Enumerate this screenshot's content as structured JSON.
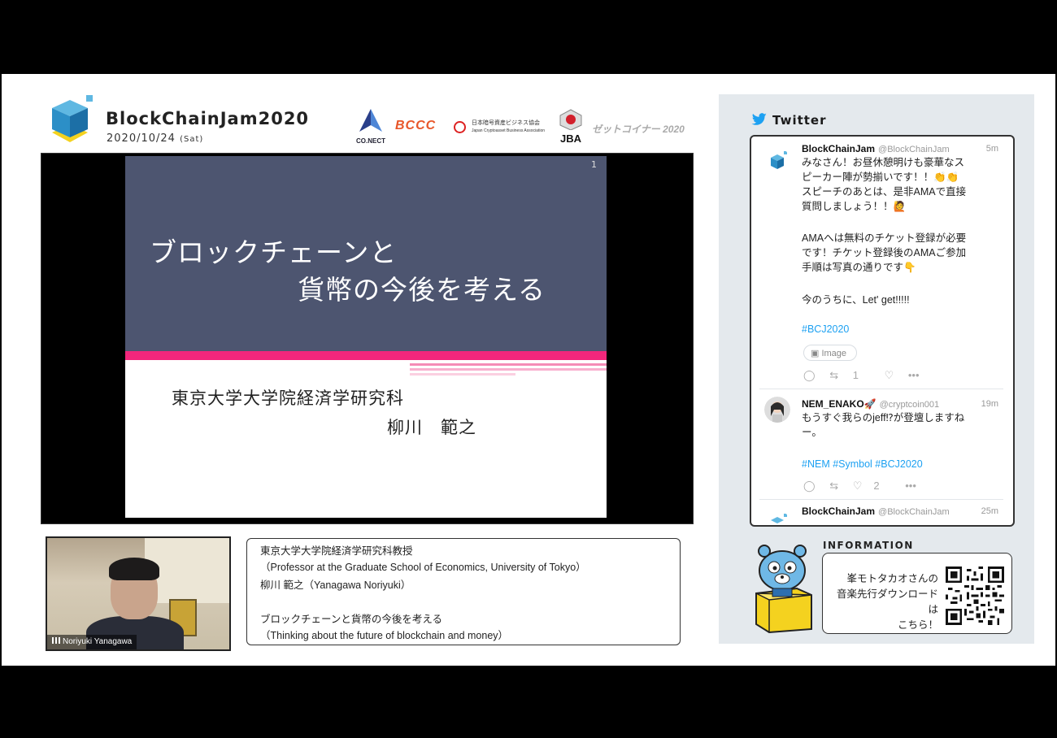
{
  "event": {
    "title": "BlockChainJam2020",
    "date": "2020/10/24",
    "day": "(Sat)"
  },
  "sponsors": {
    "conect": "CO.NECT",
    "bccc": "BCCC",
    "jcba_line1": "日本暗号資産ビジネス協会",
    "jcba_line2": "Japan Cryptoasset Business Association",
    "jba": "JBA",
    "zett": "ゼットコイナー 2020"
  },
  "slide": {
    "page_number": "1",
    "title_line1": "ブロックチェーンと",
    "title_line2": "貨幣の今後を考える",
    "affiliation": "東京大学大学院経済学研究科",
    "presenter": "柳川　範之"
  },
  "camera": {
    "participant_name": "Noriyuki Yanagawa"
  },
  "caption": {
    "line1": "東京大学大学院経済学研究科教授",
    "line2": "（Professor at the Graduate School of Economics, University of Tokyo）",
    "line3": "柳川 範之（Yanagawa Noriyuki）",
    "line4": "ブロックチェーンと貨幣の今後を考える",
    "line5": "（Thinking about the future of blockchain and money）"
  },
  "twitter": {
    "header": "Twitter",
    "tweets": [
      {
        "name": "BlockChainJam",
        "handle": "@BlockChainJam",
        "time": "5m",
        "lines": [
          "みなさん！お昼休憩明けも豪華なス",
          "ピーカー陣が勢揃いです！！👏👏",
          "スピーチのあとは、是非AMAで直接",
          "質問しましょう！！🙋"
        ],
        "lines2": [
          "AMAへは無料のチケット登録が必要",
          "です！チケット登録後のAMAご参加",
          "手順は写真の通りです👇"
        ],
        "line3": "今のうちに、Let' get!!!!!",
        "hashtags": "#BCJ2020",
        "image_label": "Image",
        "retweets": "1",
        "likes": ""
      },
      {
        "name": "NEM_ENAKO🚀",
        "handle": "@cryptcoin001",
        "time": "19m",
        "lines": [
          "もうすぐ我らのjeff⁉が登壇しますね",
          "ー。"
        ],
        "hashtags": "#NEM #Symbol #BCJ2020",
        "retweets": "",
        "likes": "2"
      },
      {
        "name": "BlockChainJam",
        "handle": "@BlockChainJam",
        "time": "25m"
      }
    ]
  },
  "information": {
    "label": "INFORMATION",
    "line1": "峯モトタカオさんの",
    "line2": "音楽先行ダウンロードは",
    "line3": "こちら！"
  },
  "colors": {
    "slide_header": "#4d5570",
    "slide_accent": "#f2277c",
    "twitter_blue": "#1da1f2",
    "panel_bg": "#e4e9ed"
  }
}
